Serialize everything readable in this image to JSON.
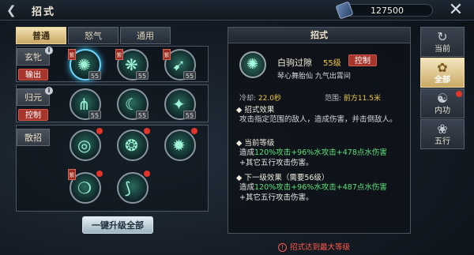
{
  "header": {
    "title": "招式",
    "currency_value": "127500"
  },
  "tabs": [
    {
      "label": "普通",
      "active": true
    },
    {
      "label": "怒气",
      "active": false
    },
    {
      "label": "通用",
      "active": false
    }
  ],
  "groups": [
    {
      "name": "玄牝",
      "tag": "输出"
    },
    {
      "name": "归元",
      "tag": "控制"
    },
    {
      "name": "散招",
      "tag": ""
    }
  ],
  "slot_level": "55",
  "slot_tag": "紫",
  "upgrade_all_label": "一键升级全部",
  "detail": {
    "header": "招式",
    "name": "白驹过隙",
    "level": "55级",
    "type_tag": "控制",
    "subtitle": "琴心舞胎仙 九气出霄间",
    "cooldown_label": "冷却:",
    "cooldown_value": "22.0秒",
    "range_label": "范围:",
    "range_value": "前方11.5米",
    "effect_title": "招式效果",
    "effect_text": "攻击指定范围的敌人，造成伤害，并击倒敌人。",
    "current_title": "当前等级",
    "current_prefix": "造成",
    "current_a": "120%攻击",
    "current_b": "+96%水攻击",
    "current_c": "+478点水伤害",
    "current_suffix": "+其它五行攻击伤害。",
    "next_title": "下一级效果（需要56级）",
    "next_prefix": "造成",
    "next_a": "120%攻击",
    "next_b": "+96%水攻击",
    "next_c": "+487点水伤害",
    "next_suffix": "+其它五行攻击伤害。",
    "warning": "招式达到最大等级"
  },
  "side_menu": [
    {
      "label": "当前",
      "icon": "swirl-icon",
      "active": false
    },
    {
      "label": "全部",
      "icon": "flower-icon",
      "active": true
    },
    {
      "label": "内功",
      "icon": "scroll-icon",
      "active": false
    },
    {
      "label": "五行",
      "icon": "lotus-icon",
      "active": false
    }
  ],
  "colors": {
    "accent_gold": "#f0c84a",
    "tag_red": "#a8352c",
    "damage_green": "#5fe07a",
    "warning_red": "#ff5a4a"
  }
}
